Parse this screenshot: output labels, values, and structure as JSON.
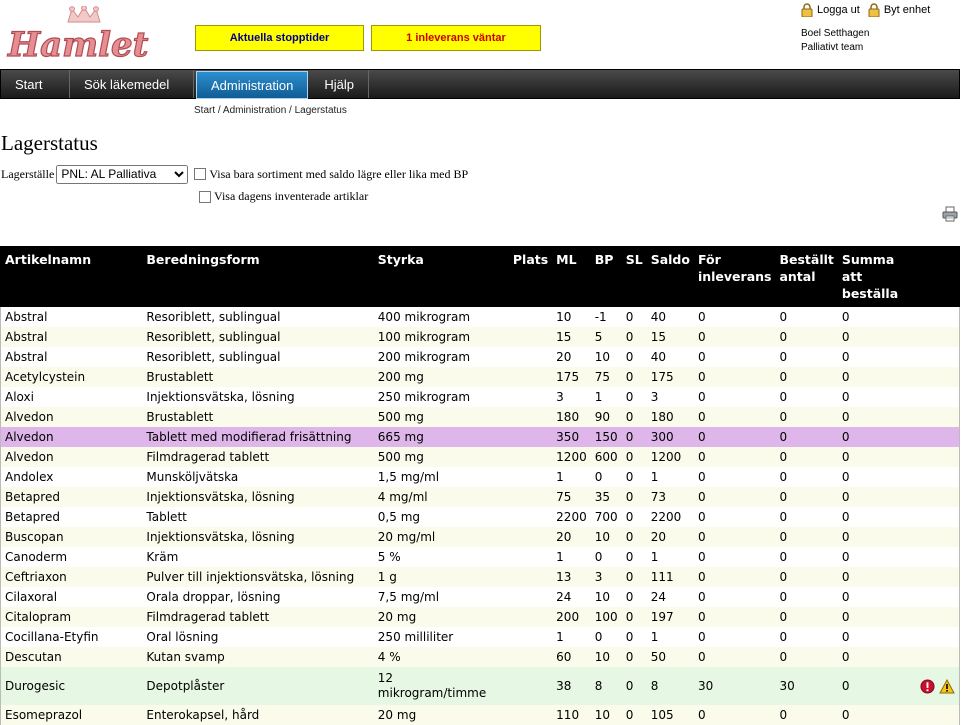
{
  "logo": {
    "text": "Hamlet"
  },
  "header_buttons": {
    "stop_times": "Aktuella stopptider",
    "deliveries_waiting": "1 inleverans väntar"
  },
  "top_links": {
    "logout": "Logga ut",
    "switch_unit": "Byt enhet"
  },
  "user": {
    "name": "Boel Setthagen",
    "team": "Palliativt team"
  },
  "nav": {
    "items": [
      {
        "label": "Start"
      },
      {
        "label": "Sök läkemedel"
      },
      {
        "label": "Administration",
        "active": true
      },
      {
        "label": "Hjälp"
      }
    ]
  },
  "breadcrumb": "Start / Administration / Lagerstatus",
  "page_title": "Lagerstatus",
  "filters": {
    "location_label": "Lagerställe",
    "location_value": "PNL: AL Palliativa",
    "checkbox_low_stock": "Visa bara sortiment med saldo lägre eller lika med BP",
    "checkbox_inventoried": "Visa dagens inventerade artiklar"
  },
  "table": {
    "headers": {
      "name": "Artikelnamn",
      "form": "Beredningsform",
      "strength": "Styrka",
      "place": "Plats",
      "ml": "ML",
      "bp": "BP",
      "sl": "SL",
      "saldo": "Saldo",
      "for_inleverans": "För inleverans",
      "bestallt_antal": "Beställt antal",
      "summa": "Summa att beställa"
    },
    "rows": [
      {
        "name": "Abstral",
        "form": "Resoriblett, sublingual",
        "strength": "400 mikrogram",
        "place": "",
        "ml": "10",
        "bp": "-1",
        "sl": "0",
        "saldo": "40",
        "fi": "0",
        "ba": "0",
        "sum": "0",
        "style": "odd"
      },
      {
        "name": "Abstral",
        "form": "Resoriblett, sublingual",
        "strength": "100 mikrogram",
        "place": "",
        "ml": "15",
        "bp": "5",
        "sl": "0",
        "saldo": "15",
        "fi": "0",
        "ba": "0",
        "sum": "0",
        "style": "even"
      },
      {
        "name": "Abstral",
        "form": "Resoriblett, sublingual",
        "strength": "200 mikrogram",
        "place": "",
        "ml": "20",
        "bp": "10",
        "sl": "0",
        "saldo": "40",
        "fi": "0",
        "ba": "0",
        "sum": "0",
        "style": "odd"
      },
      {
        "name": "Acetylcystein",
        "form": "Brustablett",
        "strength": "200 mg",
        "place": "",
        "ml": "175",
        "bp": "75",
        "sl": "0",
        "saldo": "175",
        "fi": "0",
        "ba": "0",
        "sum": "0",
        "style": "even"
      },
      {
        "name": "Aloxi",
        "form": "Injektionsvätska, lösning",
        "strength": "250 mikrogram",
        "place": "",
        "ml": "3",
        "bp": "1",
        "sl": "0",
        "saldo": "3",
        "fi": "0",
        "ba": "0",
        "sum": "0",
        "style": "odd"
      },
      {
        "name": "Alvedon",
        "form": "Brustablett",
        "strength": "500 mg",
        "place": "",
        "ml": "180",
        "bp": "90",
        "sl": "0",
        "saldo": "180",
        "fi": "0",
        "ba": "0",
        "sum": "0",
        "style": "even"
      },
      {
        "name": "Alvedon",
        "form": "Tablett med modifierad frisättning",
        "strength": "665 mg",
        "place": "",
        "ml": "350",
        "bp": "150",
        "sl": "0",
        "saldo": "300",
        "fi": "0",
        "ba": "0",
        "sum": "0",
        "style": "hl"
      },
      {
        "name": "Alvedon",
        "form": "Filmdragerad tablett",
        "strength": "500 mg",
        "place": "",
        "ml": "1200",
        "bp": "600",
        "sl": "0",
        "saldo": "1200",
        "fi": "0",
        "ba": "0",
        "sum": "0",
        "style": "even"
      },
      {
        "name": "Andolex",
        "form": "Munsköljvätska",
        "strength": "1,5 mg/ml",
        "place": "",
        "ml": "1",
        "bp": "0",
        "sl": "0",
        "saldo": "1",
        "fi": "0",
        "ba": "0",
        "sum": "0",
        "style": "odd"
      },
      {
        "name": "Betapred",
        "form": "Injektionsvätska, lösning",
        "strength": "4 mg/ml",
        "place": "",
        "ml": "75",
        "bp": "35",
        "sl": "0",
        "saldo": "73",
        "fi": "0",
        "ba": "0",
        "sum": "0",
        "style": "even"
      },
      {
        "name": "Betapred",
        "form": "Tablett",
        "strength": "0,5 mg",
        "place": "",
        "ml": "2200",
        "bp": "700",
        "sl": "0",
        "saldo": "2200",
        "fi": "0",
        "ba": "0",
        "sum": "0",
        "style": "odd"
      },
      {
        "name": "Buscopan",
        "form": "Injektionsvätska, lösning",
        "strength": "20 mg/ml",
        "place": "",
        "ml": "20",
        "bp": "10",
        "sl": "0",
        "saldo": "20",
        "fi": "0",
        "ba": "0",
        "sum": "0",
        "style": "even"
      },
      {
        "name": "Canoderm",
        "form": "Kräm",
        "strength": "5 %",
        "place": "",
        "ml": "1",
        "bp": "0",
        "sl": "0",
        "saldo": "1",
        "fi": "0",
        "ba": "0",
        "sum": "0",
        "style": "odd"
      },
      {
        "name": "Ceftriaxon",
        "form": "Pulver till injektionsvätska, lösning",
        "strength": "1 g",
        "place": "",
        "ml": "13",
        "bp": "3",
        "sl": "0",
        "saldo": "111",
        "fi": "0",
        "ba": "0",
        "sum": "0",
        "style": "even"
      },
      {
        "name": "Cilaxoral",
        "form": "Orala droppar, lösning",
        "strength": "7,5 mg/ml",
        "place": "",
        "ml": "24",
        "bp": "10",
        "sl": "0",
        "saldo": "24",
        "fi": "0",
        "ba": "0",
        "sum": "0",
        "style": "odd"
      },
      {
        "name": "Citalopram",
        "form": "Filmdragerad tablett",
        "strength": "20 mg",
        "place": "",
        "ml": "200",
        "bp": "100",
        "sl": "0",
        "saldo": "197",
        "fi": "0",
        "ba": "0",
        "sum": "0",
        "style": "even"
      },
      {
        "name": "Cocillana-Etyfin",
        "form": "Oral lösning",
        "strength": "250 milliliter",
        "place": "",
        "ml": "1",
        "bp": "0",
        "sl": "0",
        "saldo": "1",
        "fi": "0",
        "ba": "0",
        "sum": "0",
        "style": "odd"
      },
      {
        "name": "Descutan",
        "form": "Kutan svamp",
        "strength": "4 %",
        "place": "",
        "ml": "60",
        "bp": "10",
        "sl": "0",
        "saldo": "50",
        "fi": "0",
        "ba": "0",
        "sum": "0",
        "style": "even"
      },
      {
        "name": "Durogesic",
        "form": "Depotplåster",
        "strength": "12 mikrogram/timme",
        "place": "",
        "ml": "38",
        "bp": "8",
        "sl": "0",
        "saldo": "8",
        "fi": "30",
        "ba": "30",
        "sum": "0",
        "style": "green tall",
        "warnings": [
          "error-icon",
          "warning-icon"
        ]
      },
      {
        "name": "Esomeprazol",
        "form": "Enterokapsel, hård",
        "strength": "20 mg",
        "place": "",
        "ml": "110",
        "bp": "10",
        "sl": "0",
        "saldo": "105",
        "fi": "0",
        "ba": "0",
        "sum": "0",
        "style": "even"
      }
    ]
  },
  "colors": {
    "yellow_button": "#ffff00",
    "nav_active": "#1f75b5",
    "highlight_row": "#dfb6ea",
    "green_row": "#e6f8e3",
    "striped_row": "#fafbeb"
  }
}
